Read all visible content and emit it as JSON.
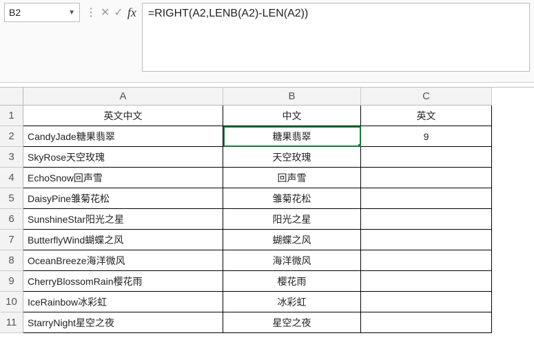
{
  "namebox": {
    "value": "B2"
  },
  "formula_bar": {
    "formula": "=RIGHT(A2,LENB(A2)-LEN(A2))"
  },
  "columns": [
    "A",
    "B",
    "C"
  ],
  "rows": [
    "1",
    "2",
    "3",
    "4",
    "5",
    "6",
    "7",
    "8",
    "9",
    "10",
    "11"
  ],
  "headers": {
    "A": "英文中文",
    "B": "中文",
    "C": "英文"
  },
  "data": [
    {
      "A": "CandyJade糖果翡翠",
      "B": "糖果翡翠",
      "C": "9"
    },
    {
      "A": "SkyRose天空玫瑰",
      "B": "天空玫瑰",
      "C": ""
    },
    {
      "A": "EchoSnow回声雪",
      "B": "回声雪",
      "C": ""
    },
    {
      "A": "DaisyPine雏菊花松",
      "B": "雏菊花松",
      "C": ""
    },
    {
      "A": "SunshineStar阳光之星",
      "B": "阳光之星",
      "C": ""
    },
    {
      "A": "ButterflyWind蝴蝶之风",
      "B": "蝴蝶之风",
      "C": ""
    },
    {
      "A": "OceanBreeze海洋微风",
      "B": "海洋微风",
      "C": ""
    },
    {
      "A": "CherryBlossomRain樱花雨",
      "B": "樱花雨",
      "C": ""
    },
    {
      "A": "IceRainbow冰彩虹",
      "B": "冰彩虹",
      "C": ""
    },
    {
      "A": "StarryNight星空之夜",
      "B": "星空之夜",
      "C": ""
    }
  ],
  "selected_cell": "B2"
}
